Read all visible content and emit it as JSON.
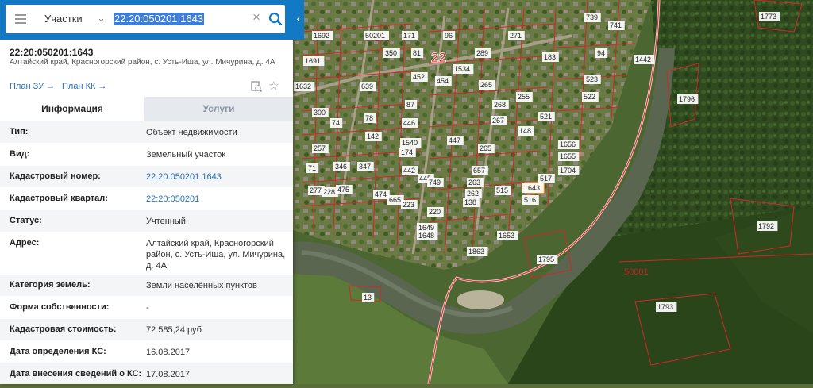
{
  "search": {
    "category": "Участки",
    "query": "22:20:050201:1643"
  },
  "object": {
    "title": "22:20:050201:1643",
    "address": "Алтайский край, Красногорский район, с. Усть-Иша, ул. Мичурина, д. 4А"
  },
  "links": {
    "plan_zu": "План ЗУ →",
    "plan_kk": "План КК →"
  },
  "tabs": {
    "info": "Информация",
    "services": "Услуги"
  },
  "rows": [
    {
      "label": "Тип:",
      "value": "Объект недвижимости"
    },
    {
      "label": "Вид:",
      "value": "Земельный участок"
    },
    {
      "label": "Кадастровый номер:",
      "value": "22:20:050201:1643"
    },
    {
      "label": "Кадастровый квартал:",
      "value": "22:20:050201"
    },
    {
      "label": "Статус:",
      "value": "Учтенный"
    },
    {
      "label": "Адрес:",
      "value": "Алтайский край, Красногорский район, с. Усть-Иша, ул. Мичурина, д. 4А"
    },
    {
      "label": "Категория земель:",
      "value": "Земли населённых пунктов"
    },
    {
      "label": "Форма собственности:",
      "value": "-"
    },
    {
      "label": "Кадастровая стоимость:",
      "value": "72 585,24 руб."
    },
    {
      "label": "Дата определения КС:",
      "value": "16.08.2017"
    },
    {
      "label": "Дата внесения сведений о КС:",
      "value": "17.08.2017"
    }
  ],
  "map": {
    "block_labels": [
      "22",
      "50201",
      "50001"
    ],
    "selected_parcel": "1643",
    "parcel_labels": [
      "1692",
      "1691",
      "1632",
      "50201",
      "171",
      "350",
      "81",
      "96",
      "289",
      "271",
      "183",
      "739",
      "741",
      "1442",
      "1773",
      "1534",
      "639",
      "452",
      "454",
      "94",
      "523",
      "522",
      "1796",
      "265",
      "87",
      "268",
      "255",
      "521",
      "300",
      "78",
      "446",
      "74",
      "142",
      "267",
      "148",
      "1540",
      "447",
      "1656",
      "174",
      "265",
      "1655",
      "1704",
      "257",
      "71",
      "346",
      "347",
      "442",
      "445",
      "657",
      "517",
      "1643",
      "749",
      "263",
      "515",
      "277",
      "228",
      "475",
      "474",
      "665",
      "223",
      "262",
      "138",
      "516",
      "220",
      "1649",
      "1648",
      "1863",
      "1653",
      "1795",
      "13",
      "1793",
      "1792"
    ]
  }
}
